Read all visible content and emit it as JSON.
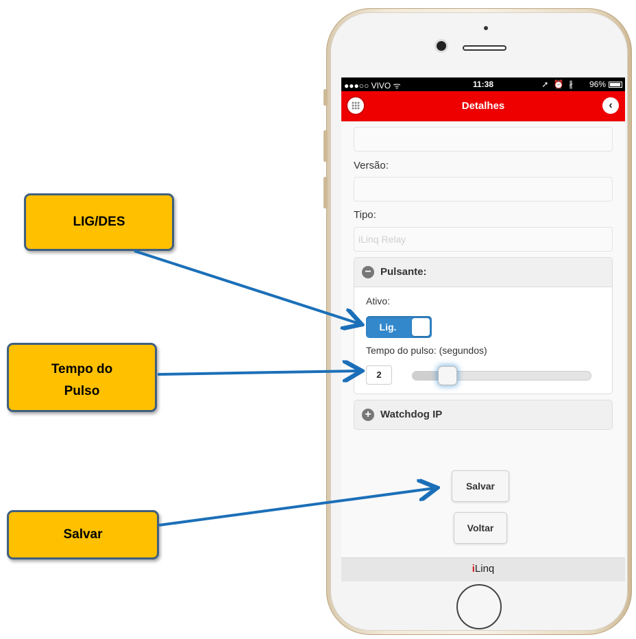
{
  "status_bar": {
    "carrier": "●●●○○ VIVO ᯤ",
    "time": "11:38",
    "indicators": "➚ ⏰ ∦",
    "battery": "96%"
  },
  "header": {
    "title": "Detalhes",
    "menu_icon": "grid-icon",
    "back_icon": "chevron-left-icon",
    "back_glyph": "‹",
    "color": "#ee0000"
  },
  "form": {
    "first_field_value": "",
    "version_label": "Versão:",
    "version_value": "",
    "type_label": "Tipo:",
    "type_placeholder": "iLinq Relay"
  },
  "pulsante": {
    "title": "Pulsante:",
    "icon": "minus-circle-icon",
    "glyph": "−",
    "active_label": "Ativo:",
    "toggle_label": "Lig.",
    "toggle_on": true,
    "pulse_time_label": "Tempo do pulso: (segundos)",
    "pulse_time_value": "2",
    "slider_fraction": 0.2
  },
  "watchdog": {
    "title": "Watchdog IP",
    "icon": "plus-circle-icon",
    "glyph": "+"
  },
  "buttons": {
    "save": "Salvar",
    "back": "Voltar"
  },
  "footer": {
    "logo_i": "i",
    "logo_rest": "Linq"
  },
  "callouts": {
    "toggle": "LIG/DES",
    "pulse_line1": "Tempo do",
    "pulse_line2": "Pulso",
    "save": "Salvar"
  },
  "colors": {
    "accent_blue": "#3388cc",
    "callout_fill": "#ffc000",
    "callout_border": "#3f5f7f",
    "arrow": "#1b6fb8"
  }
}
